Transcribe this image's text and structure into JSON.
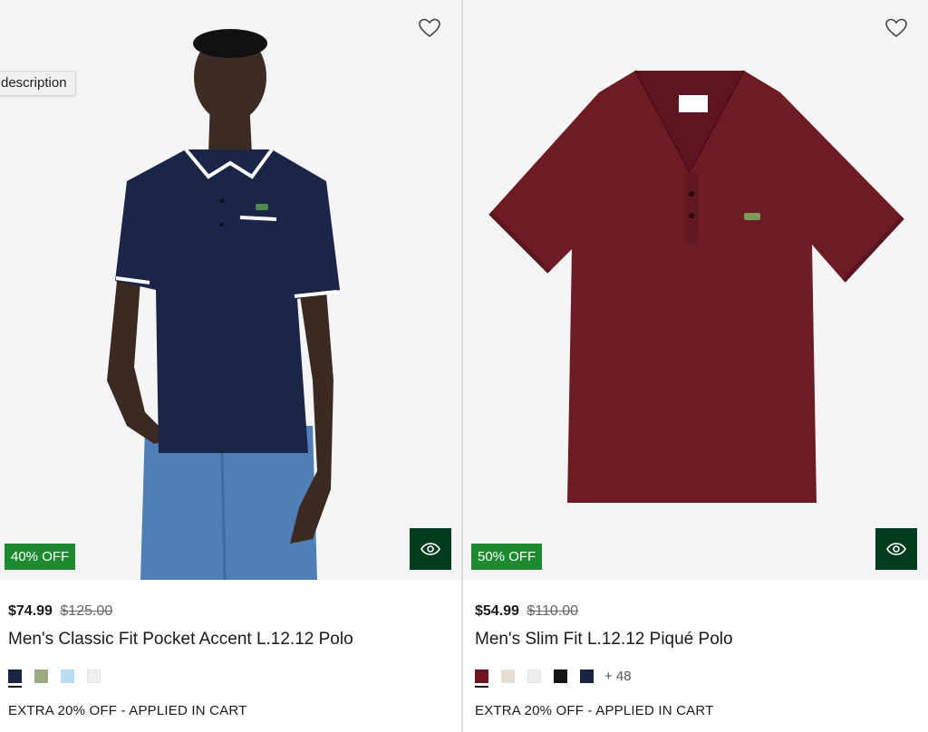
{
  "tooltip": {
    "text": "description"
  },
  "products": [
    {
      "discount": "40% OFF",
      "price": "$74.99",
      "old_price": "$125.00",
      "name": "Men's Classic Fit Pocket Accent L.12.12 Polo",
      "promo": "EXTRA 20% OFF - APPLIED IN CART",
      "swatches": [
        "#1b2440",
        "#9aab84",
        "#b8dcf2",
        "#efefef"
      ],
      "more_colors": "",
      "shirt_color": "#1a2548",
      "icons": {
        "wishlist": "heart-icon",
        "quickview": "eye-icon"
      }
    },
    {
      "discount": "50% OFF",
      "price": "$54.99",
      "old_price": "$110.00",
      "name": "Men's Slim Fit L.12.12 Piqué Polo",
      "promo": "EXTRA 20% OFF - APPLIED IN CART",
      "swatches": [
        "#6b1620",
        "#e7ddd0",
        "#efefef",
        "#141414",
        "#1a2340"
      ],
      "more_colors": "+ 48",
      "shirt_color": "#6e1b24",
      "icons": {
        "wishlist": "heart-icon",
        "quickview": "eye-icon"
      }
    }
  ],
  "colors": {
    "accent_green": "#003d1f",
    "discount_green": "#1d8a2f"
  }
}
